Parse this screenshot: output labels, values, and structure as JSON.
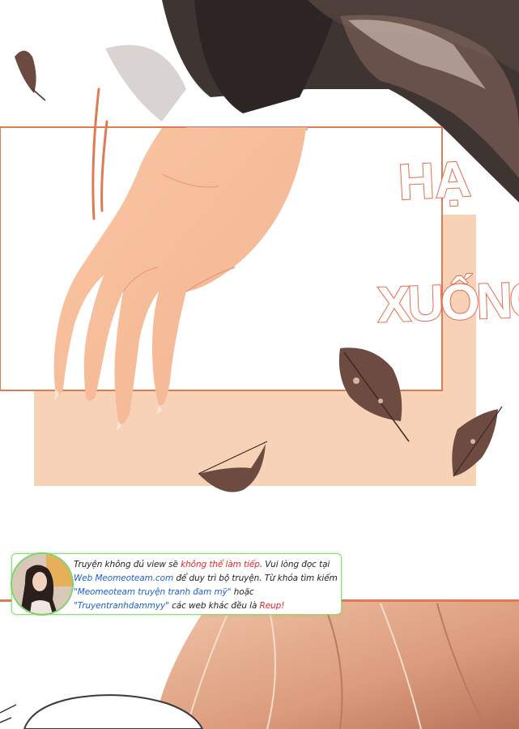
{
  "sfx": {
    "line1": "HẠ",
    "line2": "XUỐNG"
  },
  "notice": {
    "part1": "Truyện không đủ view sẽ ",
    "part1_red": "không thể làm tiếp",
    "part1_end": ". Vui lòng đọc tại",
    "part2_blue": "Web Meomeoteam.com",
    "part2_end": " để duy trì bộ truyện. Từ khóa tìm kiếm",
    "part3_blue": "\"Meomeoteam truyện tranh đam mỹ\"",
    "part3_end": " hoặc",
    "part4_blue": "\"Truyentranhdammyy\"",
    "part4_mid": " các web khác đều là ",
    "part4_red": "Reup!"
  },
  "colors": {
    "accent_red": "#e8232a",
    "link_blue": "#1e5fd6",
    "border_green": "#8fe07a",
    "frame_orange": "#e07a55",
    "peach": "#f7d2b6"
  }
}
